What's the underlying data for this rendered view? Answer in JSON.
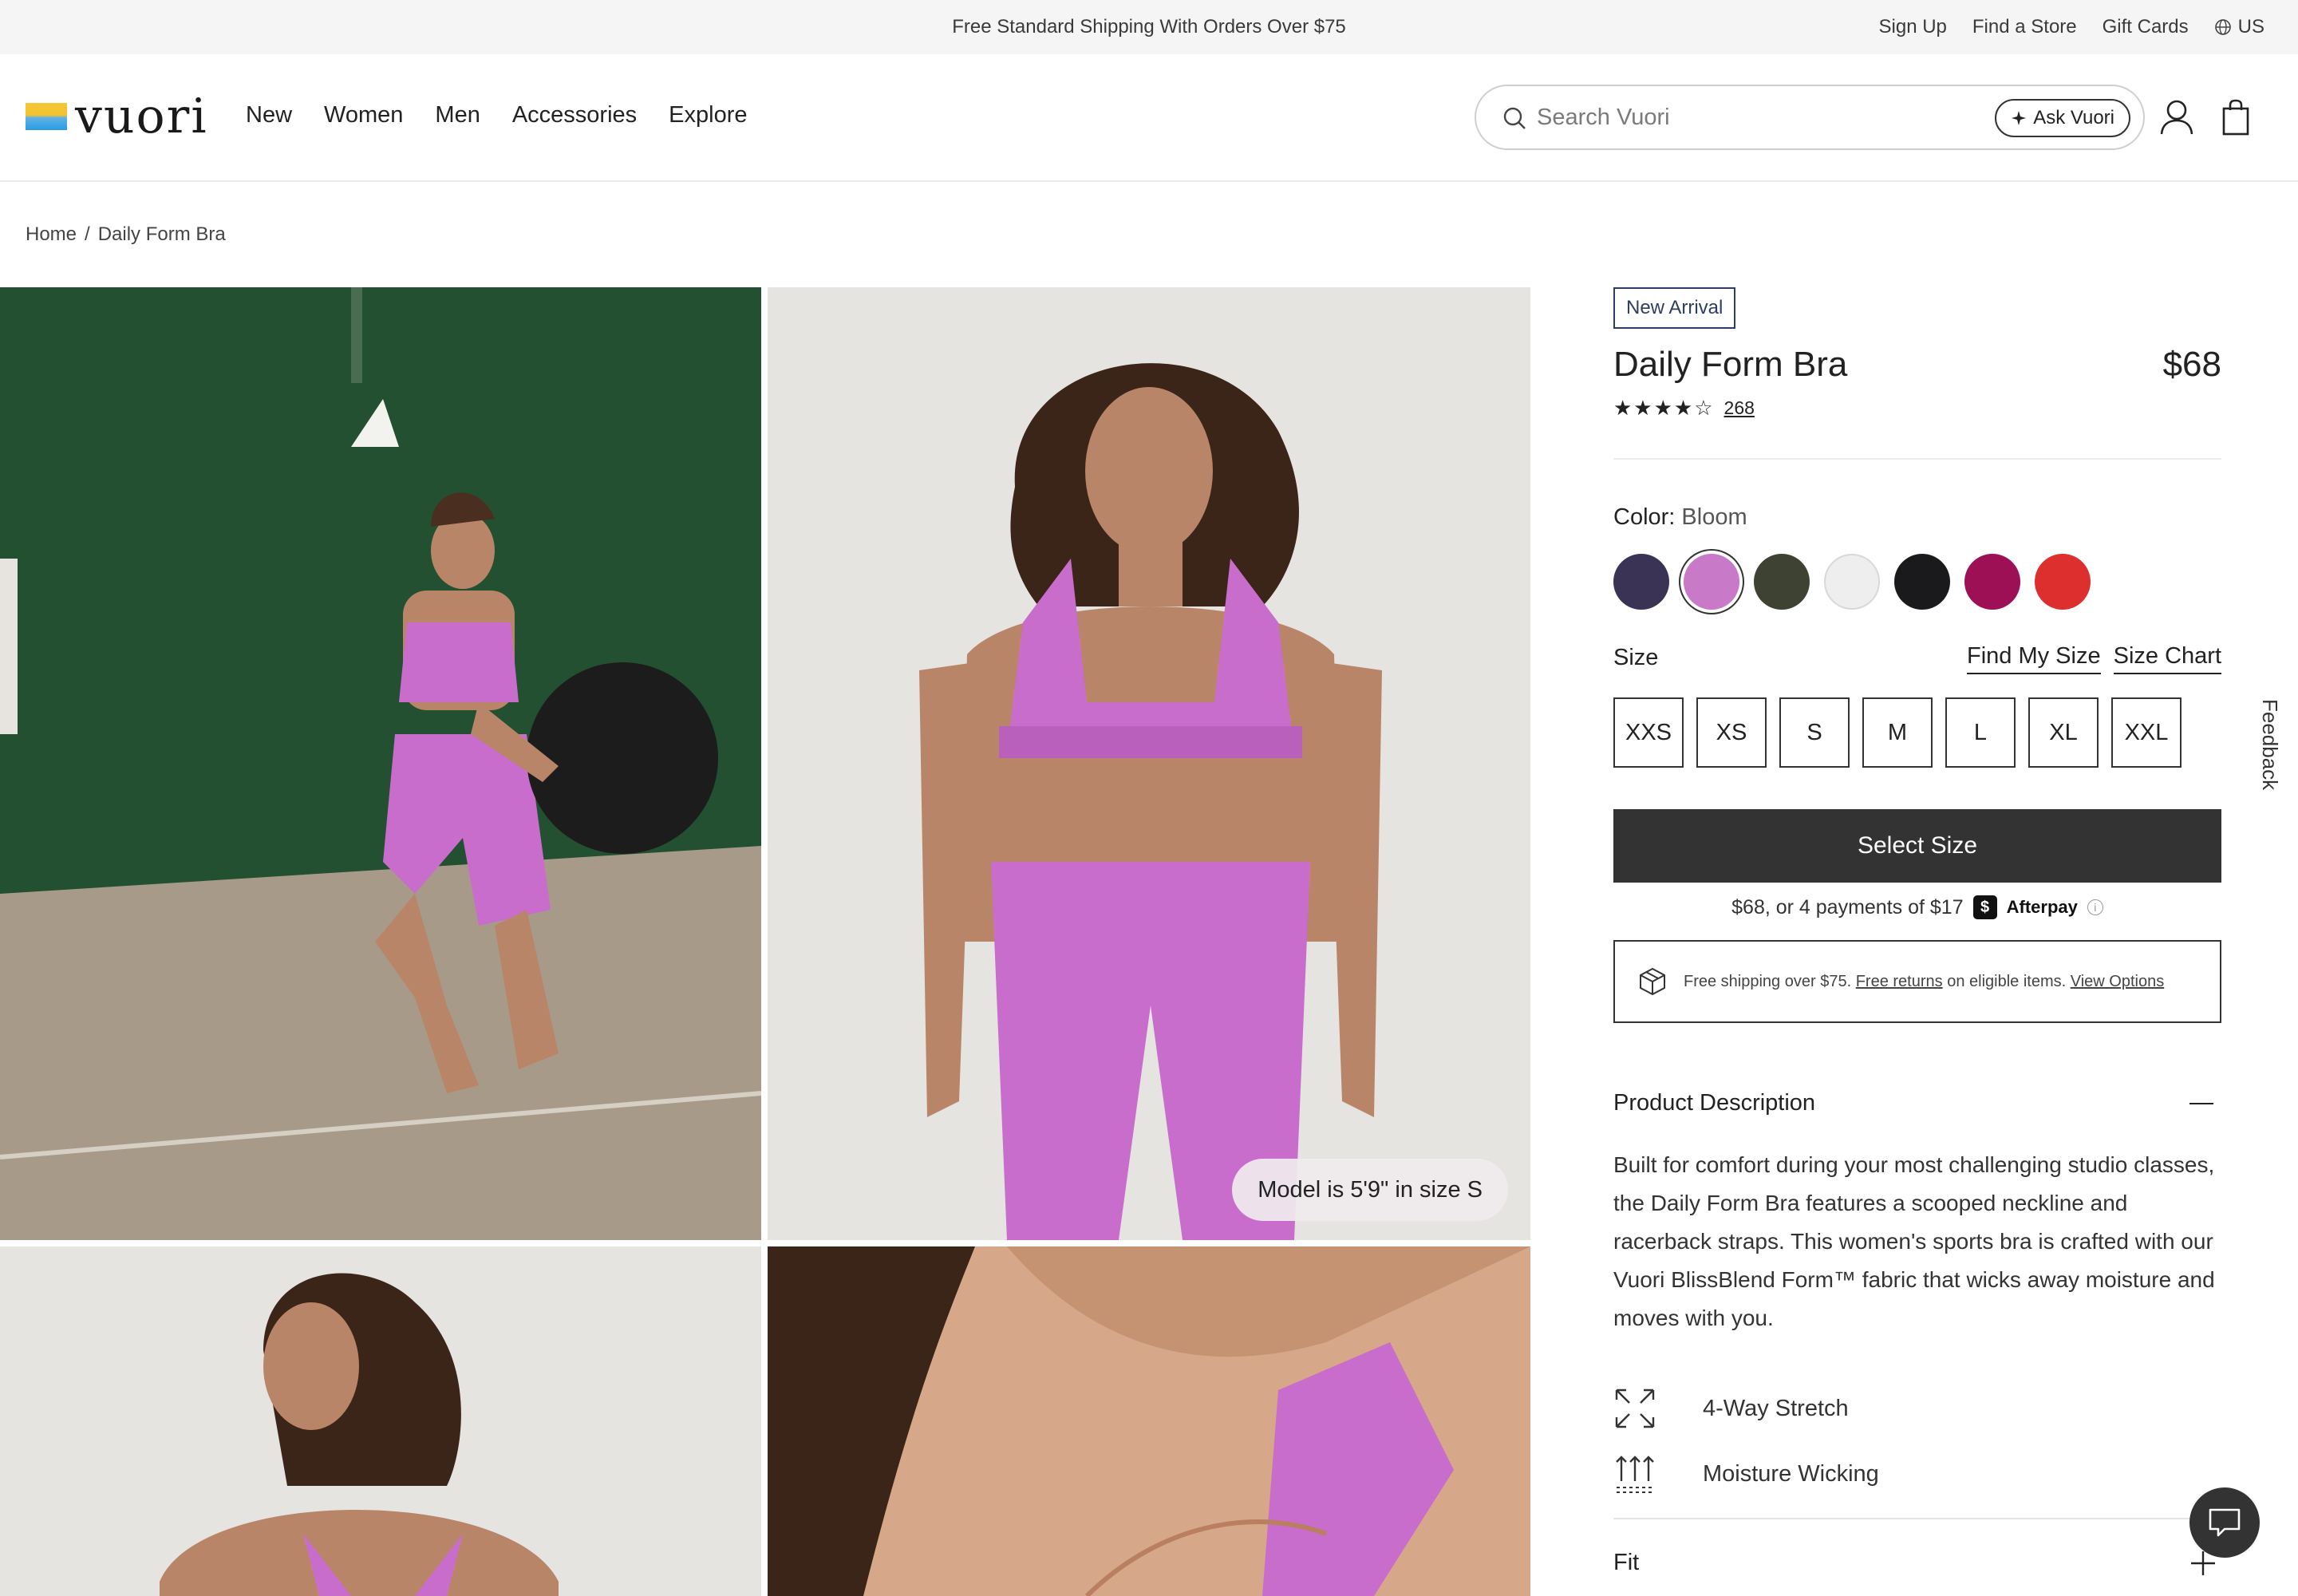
{
  "promo": {
    "text": "Free Standard Shipping With Orders Over $75",
    "links": {
      "sign_up": "Sign Up",
      "find_store": "Find a Store",
      "gift_cards": "Gift Cards",
      "region": "US"
    }
  },
  "header": {
    "logo_text": "vuori",
    "nav": {
      "new": "New",
      "women": "Women",
      "men": "Men",
      "accessories": "Accessories",
      "explore": "Explore"
    },
    "search": {
      "placeholder": "Search Vuori",
      "ask_label": "Ask Vuori"
    }
  },
  "breadcrumb": {
    "home": "Home",
    "separator": "/",
    "current": "Daily Form Bra"
  },
  "gallery": {
    "model_note": "Model is 5'9\" in size S"
  },
  "product": {
    "badge": "New Arrival",
    "title": "Daily Form Bra",
    "price": "$68",
    "rating": {
      "stars": 4.5,
      "stars_glyph": "★★★★☆",
      "review_count": "268"
    },
    "color": {
      "label": "Color:",
      "selected": "Bloom",
      "swatches": [
        {
          "name": "navy",
          "hex": "#3a3356"
        },
        {
          "name": "bloom",
          "hex": "#c879c8"
        },
        {
          "name": "olive",
          "hex": "#3e4232"
        },
        {
          "name": "white",
          "hex": "#eeeeee"
        },
        {
          "name": "black",
          "hex": "#1a1a1c"
        },
        {
          "name": "magenta",
          "hex": "#9e1056"
        },
        {
          "name": "red",
          "hex": "#de2f2f"
        }
      ]
    },
    "size": {
      "label": "Size",
      "find_my_size": "Find My Size",
      "size_chart": "Size Chart",
      "options": [
        "XXS",
        "XS",
        "S",
        "M",
        "L",
        "XL",
        "XXL"
      ]
    },
    "select_button": "Select Size",
    "afterpay": {
      "text": "$68, or 4 payments of $17",
      "brand": "Afterpay",
      "logo_glyph": "$",
      "info_glyph": "i"
    },
    "shipping": {
      "text1": "Free shipping over $75.",
      "free_returns": "Free returns",
      "text2": "on eligible items.",
      "view_options": "View Options"
    },
    "description": {
      "heading": "Product Description",
      "body": "Built for comfort during your most challenging studio classes, the Daily Form Bra features a scooped neckline and racerback straps. This women's sports bra is crafted with our Vuori BlissBlend Form™ fabric that wicks away moisture and moves with you."
    },
    "features": [
      "4-Way Stretch",
      "Moisture Wicking"
    ],
    "fit_heading": "Fit"
  },
  "side": {
    "feedback": "Feedback"
  },
  "colors": {
    "accent_dark": "#333333",
    "badge_navy": "#2c3e63",
    "product_pink": "#c96dcc"
  }
}
